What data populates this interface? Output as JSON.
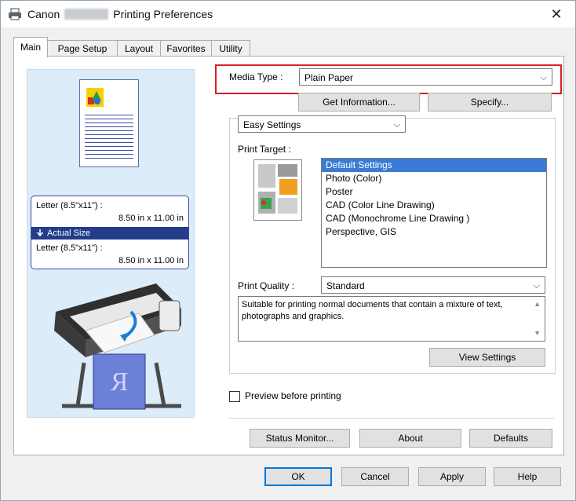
{
  "window": {
    "title_prefix": "Canon",
    "title_suffix": "Printing Preferences",
    "close_glyph": "✕"
  },
  "tabs": [
    {
      "label": "Main"
    },
    {
      "label": "Page Setup"
    },
    {
      "label": "Layout"
    },
    {
      "label": "Favorites"
    },
    {
      "label": "Utility"
    }
  ],
  "preview": {
    "input_size": "Letter (8.5\"x11\") :",
    "input_dims": "8.50 in x 11.00 in",
    "scale_label": "Actual Size",
    "output_size": "Letter (8.5\"x11\") :",
    "output_dims": "8.50 in x 11.00 in",
    "printer_letter": "R"
  },
  "media": {
    "label": "Media Type :",
    "value": "Plain Paper",
    "get_info_label": "Get Information...",
    "specify_label": "Specify..."
  },
  "settings_mode": {
    "value": "Easy Settings"
  },
  "print_target": {
    "label": "Print Target :",
    "items": [
      "Default Settings",
      "Photo (Color)",
      "Poster",
      "CAD (Color Line Drawing)",
      "CAD (Monochrome Line Drawing )",
      "Perspective, GIS"
    ],
    "selected": 0
  },
  "print_quality": {
    "label": "Print Quality :",
    "value": "Standard",
    "description": "Suitable for printing normal documents that contain a mixture of text, photographs and graphics.",
    "view_settings_label": "View Settings"
  },
  "preview_before": {
    "label": "Preview before printing",
    "checked": false
  },
  "panel_buttons": {
    "status_monitor": "Status Monitor...",
    "about": "About",
    "defaults": "Defaults"
  },
  "footer": {
    "ok": "OK",
    "cancel": "Cancel",
    "apply": "Apply",
    "help": "Help"
  },
  "colors": {
    "highlight_red": "#d61f2a",
    "selection_blue": "#3a7bd5",
    "size_bar_blue": "#233d8c",
    "preview_bg": "#dcecf8"
  }
}
